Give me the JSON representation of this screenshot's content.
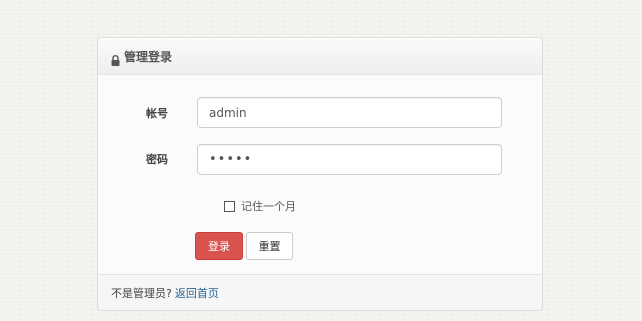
{
  "panel": {
    "title": "管理登录"
  },
  "form": {
    "username_label": "帐号",
    "username_value": "admin",
    "password_label": "密码",
    "password_value": "•••••",
    "remember_label": "记住一个月",
    "remember_checked": false,
    "login_label": "登录",
    "reset_label": "重置"
  },
  "footer": {
    "prompt_text": "不是管理员?",
    "back_link_text": "返回首页"
  },
  "colors": {
    "login_button": "#d9534f",
    "link": "#2a6496"
  }
}
